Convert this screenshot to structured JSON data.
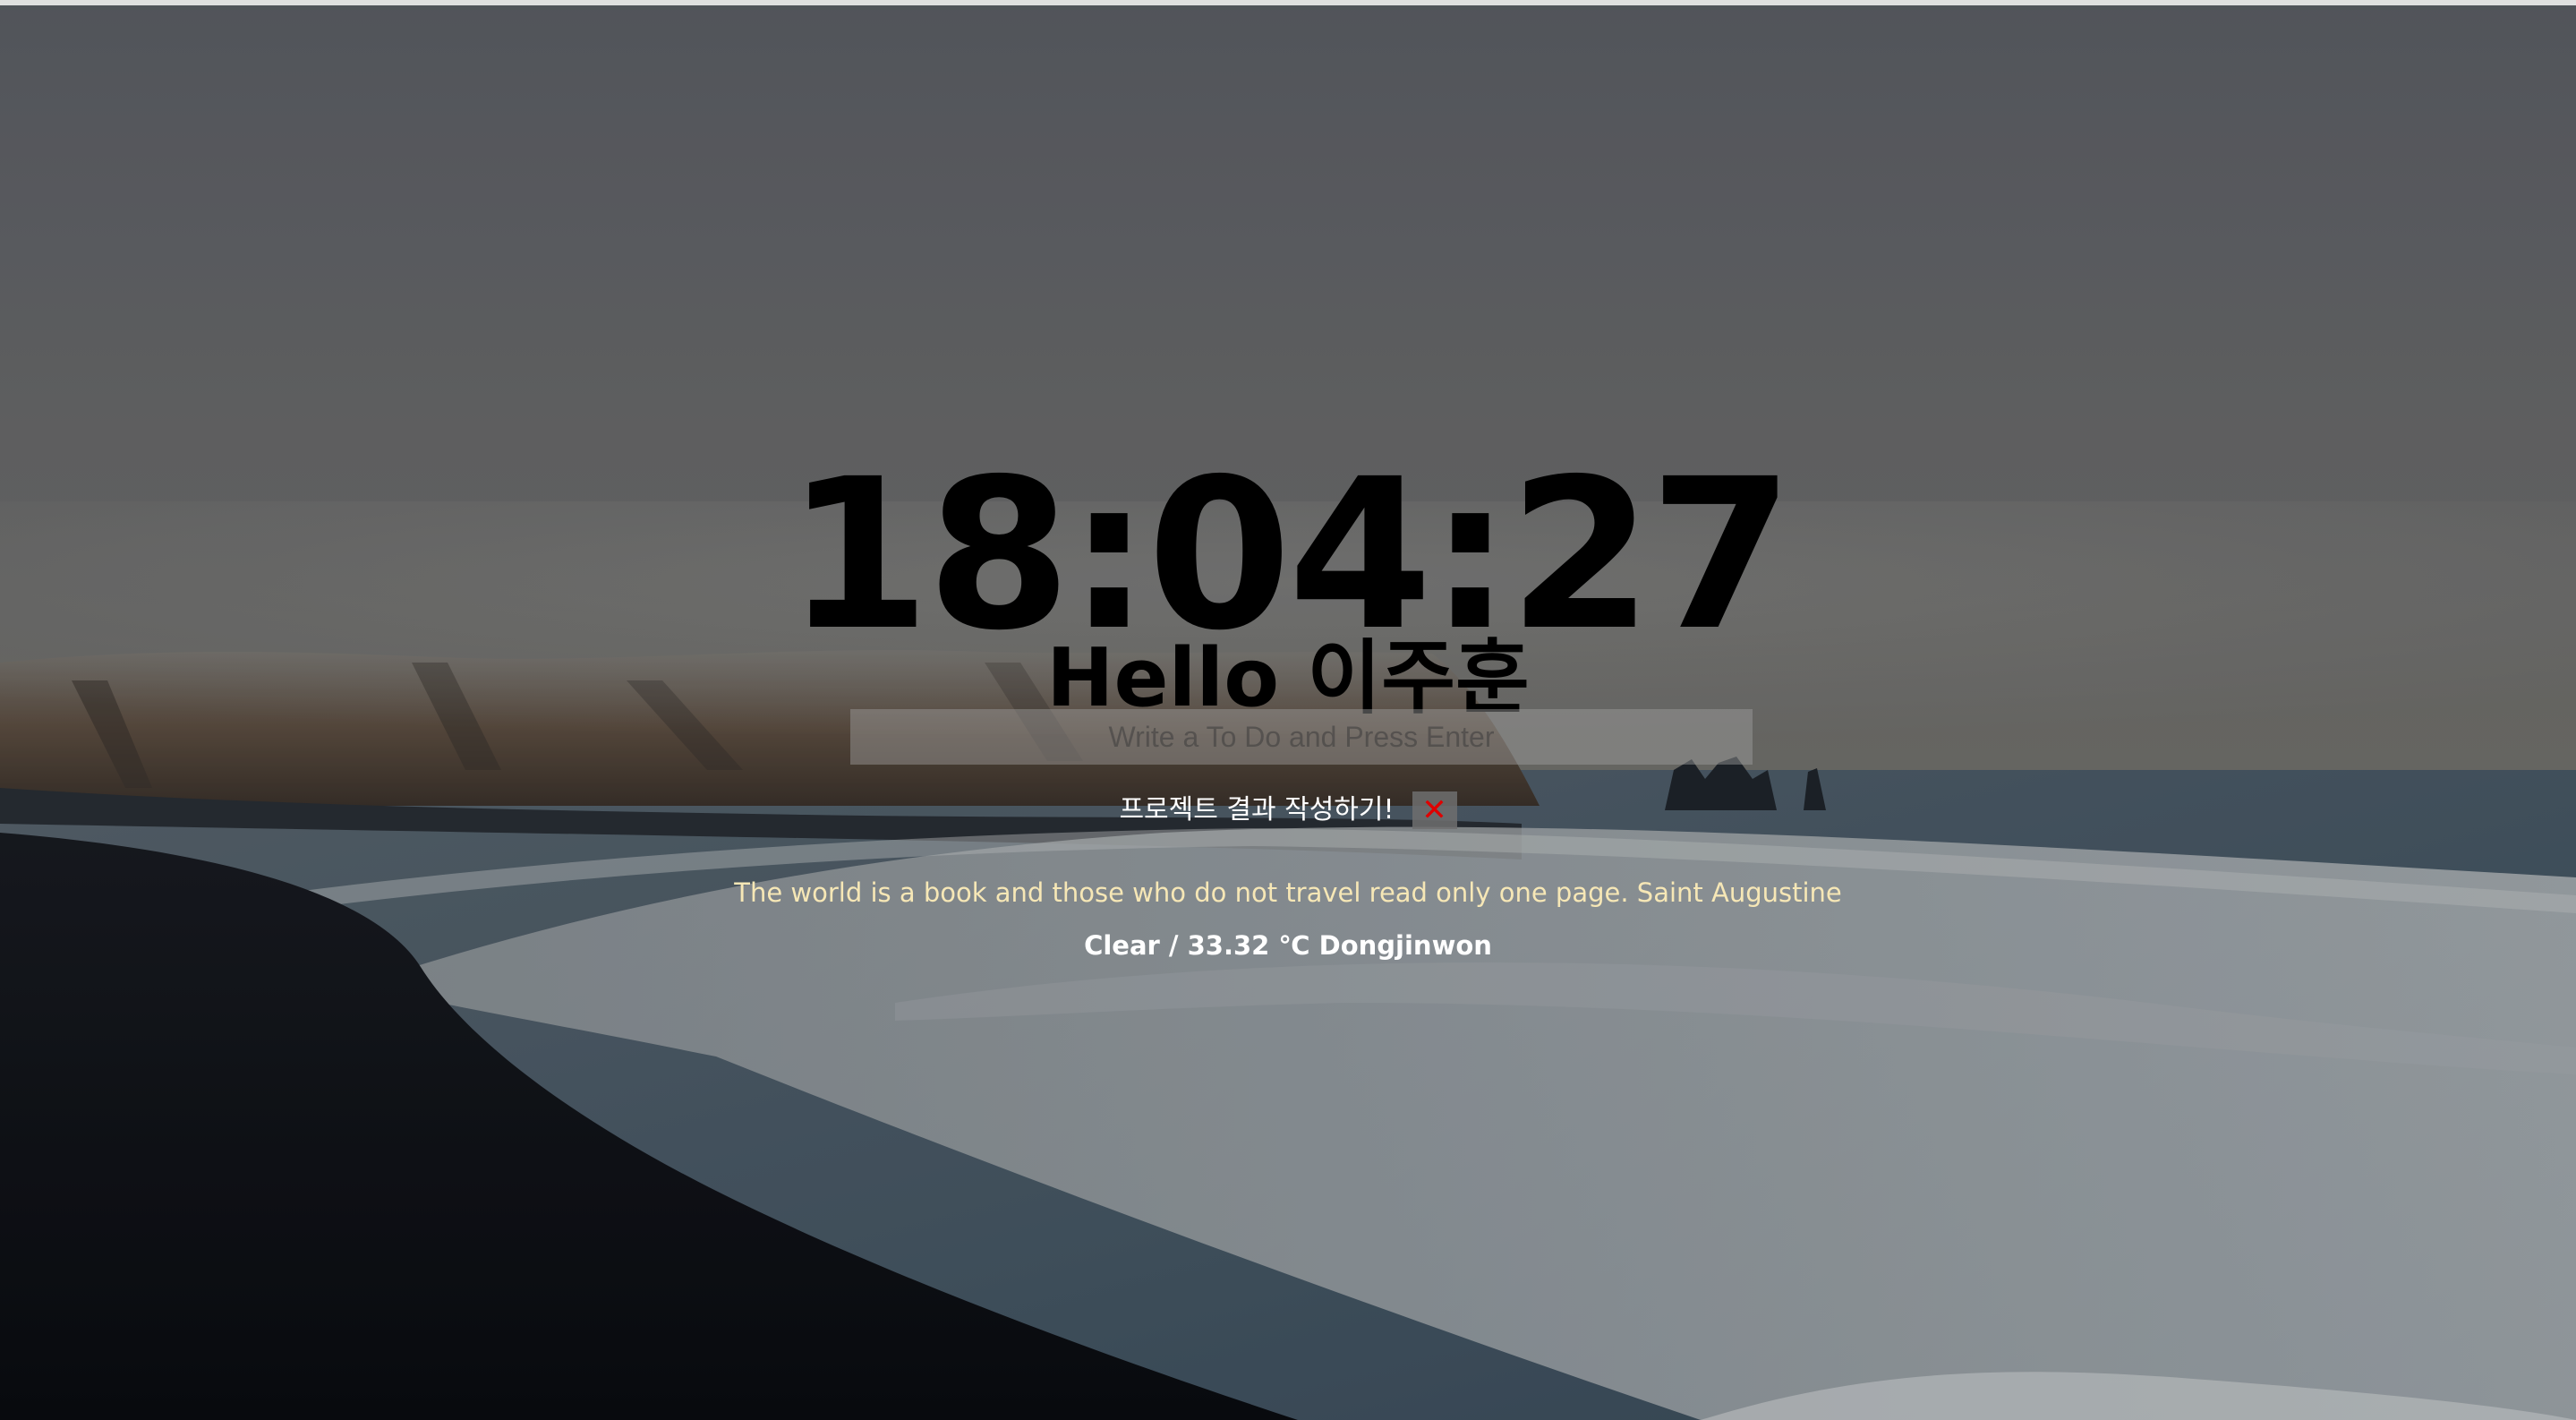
{
  "clock": {
    "time": "18:04:27"
  },
  "greeting": {
    "text": "Hello 이주훈"
  },
  "todo": {
    "placeholder": "Write a To Do and Press Enter",
    "items": [
      {
        "text": "프로젝트 결과 작성하기!",
        "delete_label": "✕"
      }
    ]
  },
  "quote": {
    "text": "The world is a book and those who do not travel read only one page. Saint Augustine"
  },
  "weather": {
    "text": "Clear / 33.32 ℃ Dongjinwon"
  },
  "colors": {
    "quote_text": "#f6e7b6",
    "delete_icon": "#e00000",
    "clock_text": "#000000"
  }
}
